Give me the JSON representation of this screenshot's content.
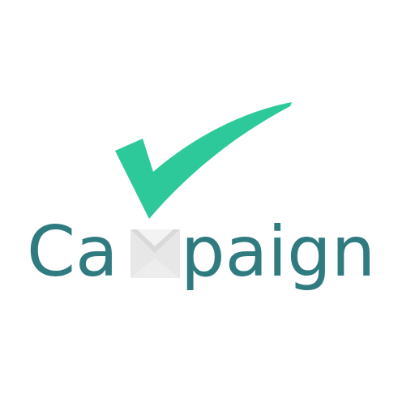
{
  "logo": {
    "wordmark": "Campaign",
    "wordmark_segments": {
      "before": "Ca",
      "after": "paign"
    },
    "icons": {
      "checkmark": "checkmark-icon",
      "envelope": "envelope-icon"
    },
    "colors": {
      "background": "#ffffff",
      "checkmark": "#2ec99a",
      "text": "#2f7b80",
      "envelope_light": "#f3f3f3",
      "envelope_shadow": "#d9d9d9"
    }
  }
}
